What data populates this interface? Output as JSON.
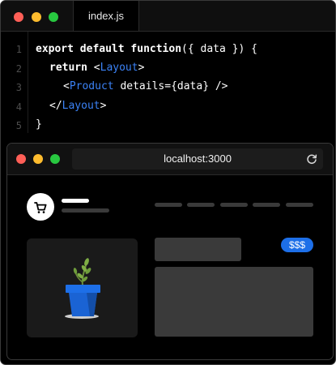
{
  "editor": {
    "tab_label": "index.js",
    "window_controls": {
      "close_color": "#ff5f57",
      "minimize_color": "#febc2e",
      "maximize_color": "#28c840"
    },
    "line_numbers": [
      "1",
      "2",
      "3",
      "4",
      "5"
    ],
    "code": {
      "line1": {
        "kw_export": "export",
        "kw_default": "default",
        "kw_function": "function",
        "rest": "({ data }) {"
      },
      "line2": {
        "kw_return": "return",
        "open": "<",
        "tag": "Layout",
        "close": ">"
      },
      "line3": {
        "open": "<",
        "tag": "Product",
        "rest": " details={data} />"
      },
      "line4": {
        "open": "</",
        "tag": "Layout",
        "close": ">"
      },
      "line5": {
        "text": "}"
      }
    },
    "colors": {
      "keyword": "#ffffff",
      "component": "#3b82f6",
      "background": "#000000"
    }
  },
  "browser": {
    "url": "localhost:3000",
    "reload_icon": "reload-icon",
    "cart_icon": "cart-icon",
    "price_badge": "$$$",
    "accent_color": "#1d6fe8",
    "product_image": "potted-plant-icon"
  }
}
